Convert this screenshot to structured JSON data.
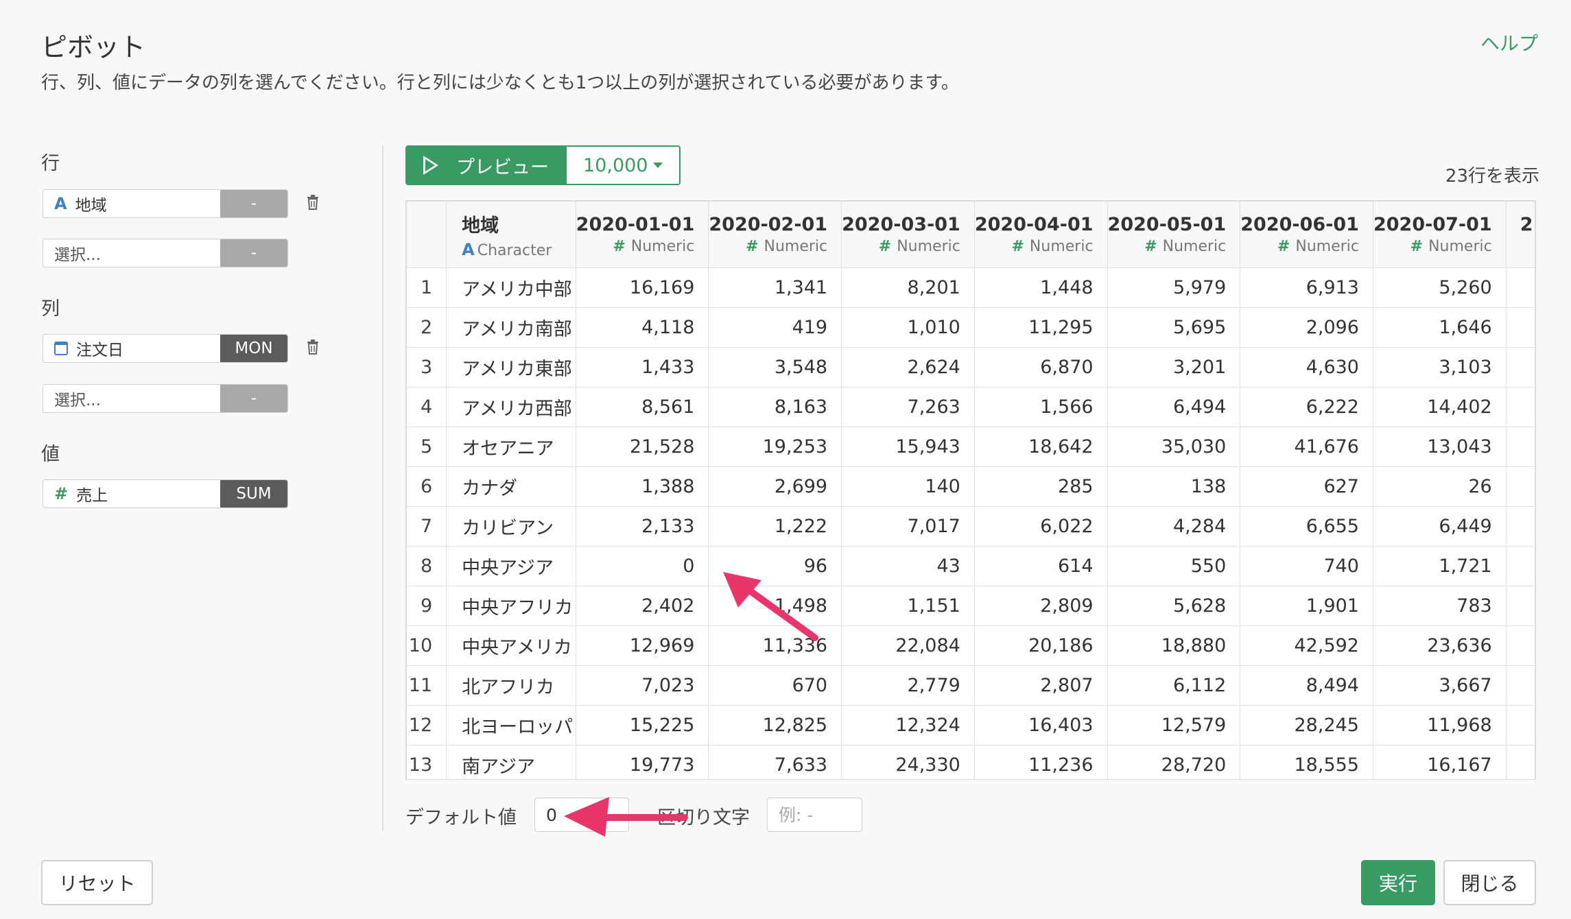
{
  "dialog": {
    "title": "ピボット",
    "help": "ヘルプ",
    "description": "行、列、値にデータの列を選んでください。行と列には少なくとも1つ以上の列が選択されている必要があります。"
  },
  "rows_section": {
    "label": "行",
    "field": {
      "name": "地域",
      "type_icon": "A",
      "agg": "-"
    },
    "select": {
      "placeholder": "選択...",
      "agg": "-"
    }
  },
  "cols_section": {
    "label": "列",
    "field": {
      "name": "注文日",
      "type_icon": "calendar-icon",
      "agg": "MON"
    },
    "select": {
      "placeholder": "選択...",
      "agg": "-"
    }
  },
  "values_section": {
    "label": "値",
    "field": {
      "name": "売上",
      "type_icon": "#",
      "agg": "SUM"
    }
  },
  "preview": {
    "button": "プレビュー",
    "limit": "10,000",
    "row_count": "23行を表示"
  },
  "table": {
    "region_col": {
      "name": "地域",
      "type_icon": "A",
      "type": "Character"
    },
    "numeric_type_icon": "#",
    "numeric_type": "Numeric",
    "date_cols": [
      "2020-01-01",
      "2020-02-01",
      "2020-03-01",
      "2020-04-01",
      "2020-05-01",
      "2020-06-01",
      "2020-07-01",
      "2"
    ],
    "rows": [
      {
        "idx": "1",
        "region": "アメリカ中部",
        "values": [
          "16,169",
          "1,341",
          "8,201",
          "1,448",
          "5,979",
          "6,913",
          "5,260"
        ]
      },
      {
        "idx": "2",
        "region": "アメリカ南部",
        "values": [
          "4,118",
          "419",
          "1,010",
          "11,295",
          "5,695",
          "2,096",
          "1,646"
        ]
      },
      {
        "idx": "3",
        "region": "アメリカ東部",
        "values": [
          "1,433",
          "3,548",
          "2,624",
          "6,870",
          "3,201",
          "4,630",
          "3,103"
        ]
      },
      {
        "idx": "4",
        "region": "アメリカ西部",
        "values": [
          "8,561",
          "8,163",
          "7,263",
          "1,566",
          "6,494",
          "6,222",
          "14,402"
        ]
      },
      {
        "idx": "5",
        "region": "オセアニア",
        "values": [
          "21,528",
          "19,253",
          "15,943",
          "18,642",
          "35,030",
          "41,676",
          "13,043"
        ]
      },
      {
        "idx": "6",
        "region": "カナダ",
        "values": [
          "1,388",
          "2,699",
          "140",
          "285",
          "138",
          "627",
          "26"
        ]
      },
      {
        "idx": "7",
        "region": "カリビアン",
        "values": [
          "2,133",
          "1,222",
          "7,017",
          "6,022",
          "4,284",
          "6,655",
          "6,449"
        ]
      },
      {
        "idx": "8",
        "region": "中央アジア",
        "values": [
          "0",
          "96",
          "43",
          "614",
          "550",
          "740",
          "1,721"
        ]
      },
      {
        "idx": "9",
        "region": "中央アフリカ",
        "values": [
          "2,402",
          "1,498",
          "1,151",
          "2,809",
          "5,628",
          "1,901",
          "783"
        ]
      },
      {
        "idx": "10",
        "region": "中央アメリカ",
        "values": [
          "12,969",
          "11,336",
          "22,084",
          "20,186",
          "18,880",
          "42,592",
          "23,636"
        ]
      },
      {
        "idx": "11",
        "region": "北アフリカ",
        "values": [
          "7,023",
          "670",
          "2,779",
          "2,807",
          "6,112",
          "8,494",
          "3,667"
        ]
      },
      {
        "idx": "12",
        "region": "北ヨーロッパ",
        "values": [
          "15,225",
          "12,825",
          "12,324",
          "16,403",
          "12,579",
          "28,245",
          "11,968"
        ]
      },
      {
        "idx": "13",
        "region": "南アジア",
        "values": [
          "19,773",
          "7,633",
          "24,330",
          "11,236",
          "28,720",
          "18,555",
          "16,167"
        ]
      }
    ]
  },
  "options": {
    "default_label": "デフォルト値",
    "default_value": "0",
    "separator_label": "区切り文字",
    "separator_placeholder": "例: -"
  },
  "footer": {
    "reset": "リセット",
    "run": "実行",
    "close": "閉じる"
  },
  "colors": {
    "accent": "#3a9a63",
    "annotation_arrow": "#e8366a"
  }
}
